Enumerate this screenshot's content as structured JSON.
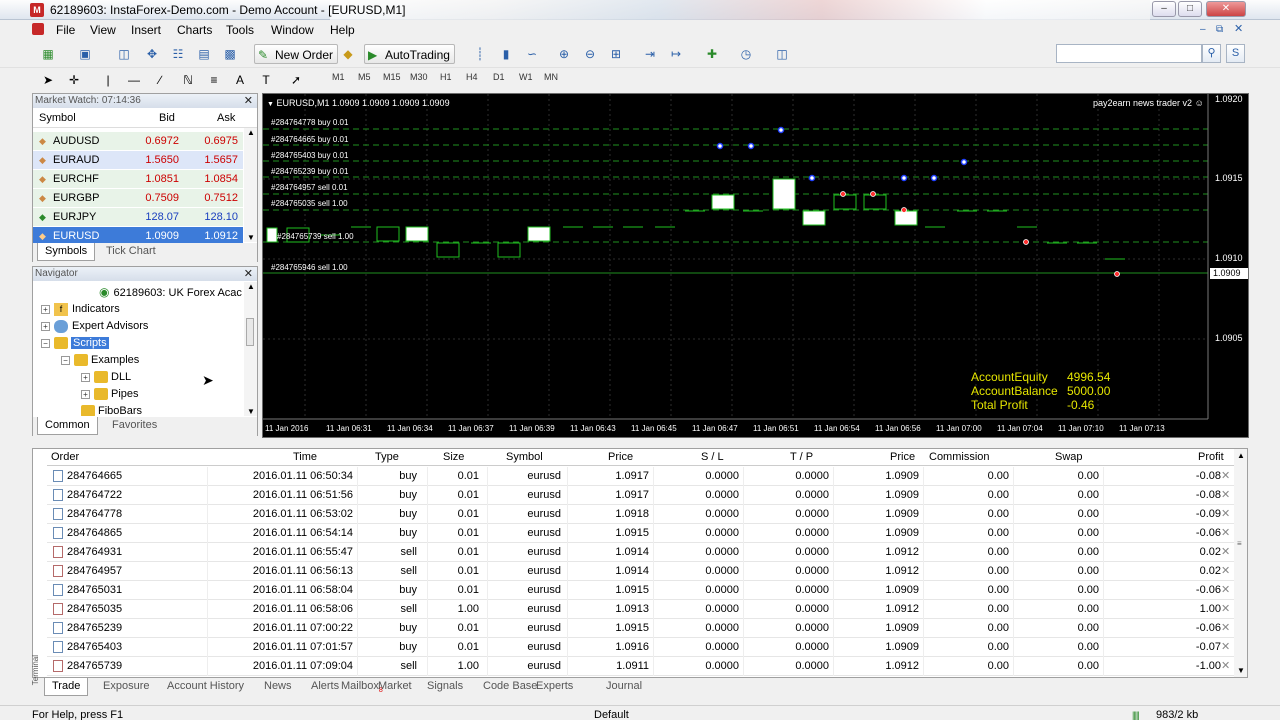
{
  "window": {
    "title": "62189603: InstaForex-Demo.com - Demo Account - [EURUSD,M1]"
  },
  "menu": [
    "File",
    "View",
    "Insert",
    "Charts",
    "Tools",
    "Window",
    "Help"
  ],
  "toolbar": {
    "new_order": "New Order",
    "autotrading": "AutoTrading"
  },
  "timeframes": [
    "M1",
    "M5",
    "M15",
    "M30",
    "H1",
    "H4",
    "D1",
    "W1",
    "MN"
  ],
  "market_watch": {
    "title": "Market Watch: 07:14:36",
    "columns": [
      "Symbol",
      "Bid",
      "Ask"
    ],
    "rows": [
      {
        "symbol": "AUDUSD",
        "bid": "0.6972",
        "ask": "0.6975"
      },
      {
        "symbol": "EURAUD",
        "bid": "1.5650",
        "ask": "1.5657"
      },
      {
        "symbol": "EURCHF",
        "bid": "1.0851",
        "ask": "1.0854"
      },
      {
        "symbol": "EURGBP",
        "bid": "0.7509",
        "ask": "0.7512"
      },
      {
        "symbol": "EURJPY",
        "bid": "128.07",
        "ask": "128.10"
      },
      {
        "symbol": "EURUSD",
        "bid": "1.0909",
        "ask": "1.0912"
      }
    ],
    "tabs": [
      "Symbols",
      "Tick Chart"
    ]
  },
  "navigator": {
    "title": "Navigator",
    "account": "62189603: UK Forex Acac",
    "items": [
      "Indicators",
      "Expert Advisors",
      "Scripts",
      "Examples",
      "DLL",
      "Pipes",
      "FiboBars"
    ],
    "tabs": [
      "Common",
      "Favorites"
    ]
  },
  "chart": {
    "header": "EURUSD,M1  1.0909 1.0909 1.0909 1.0909",
    "ea_label": "pay2earn news trader v2",
    "price_labels": [
      "1.0920",
      "1.0915",
      "1.0910",
      "1.0909",
      "1.0905"
    ],
    "time_labels": [
      "11 Jan 2016",
      "11 Jan 06:31",
      "11 Jan 06:34",
      "11 Jan 06:37",
      "11 Jan 06:39",
      "11 Jan 06:43",
      "11 Jan 06:45",
      "11 Jan 06:47",
      "11 Jan 06:51",
      "11 Jan 06:54",
      "11 Jan 06:56",
      "11 Jan 07:00",
      "11 Jan 07:04",
      "11 Jan 07:10",
      "11 Jan 07:13"
    ],
    "order_labels": [
      "#284764778 buy 0.01",
      "#284764665 buy 0.01",
      "#284765403 buy 0.01",
      "#284765239 buy 0.01",
      "#284764957 sell 0.01",
      "#284765035 sell 1.00",
      "#284765739 sell 1.00",
      "#284765946 sell 1.00"
    ],
    "info": [
      {
        "label": "AccountEquity",
        "value": "4996.54"
      },
      {
        "label": "AccountBalance",
        "value": "5000.00"
      },
      {
        "label": "Total Profit",
        "value": "-0.46"
      }
    ]
  },
  "terminal": {
    "columns": [
      "Order",
      "Time",
      "Type",
      "Size",
      "Symbol",
      "Price",
      "S / L",
      "T / P",
      "Price",
      "Commission",
      "Swap",
      "Profit"
    ],
    "rows": [
      [
        "284764665",
        "2016.01.11 06:50:34",
        "buy",
        "0.01",
        "eurusd",
        "1.0917",
        "0.0000",
        "0.0000",
        "1.0909",
        "0.00",
        "0.00",
        "-0.08"
      ],
      [
        "284764722",
        "2016.01.11 06:51:56",
        "buy",
        "0.01",
        "eurusd",
        "1.0917",
        "0.0000",
        "0.0000",
        "1.0909",
        "0.00",
        "0.00",
        "-0.08"
      ],
      [
        "284764778",
        "2016.01.11 06:53:02",
        "buy",
        "0.01",
        "eurusd",
        "1.0918",
        "0.0000",
        "0.0000",
        "1.0909",
        "0.00",
        "0.00",
        "-0.09"
      ],
      [
        "284764865",
        "2016.01.11 06:54:14",
        "buy",
        "0.01",
        "eurusd",
        "1.0915",
        "0.0000",
        "0.0000",
        "1.0909",
        "0.00",
        "0.00",
        "-0.06"
      ],
      [
        "284764931",
        "2016.01.11 06:55:47",
        "sell",
        "0.01",
        "eurusd",
        "1.0914",
        "0.0000",
        "0.0000",
        "1.0912",
        "0.00",
        "0.00",
        "0.02"
      ],
      [
        "284764957",
        "2016.01.11 06:56:13",
        "sell",
        "0.01",
        "eurusd",
        "1.0914",
        "0.0000",
        "0.0000",
        "1.0912",
        "0.00",
        "0.00",
        "0.02"
      ],
      [
        "284765031",
        "2016.01.11 06:58:04",
        "buy",
        "0.01",
        "eurusd",
        "1.0915",
        "0.0000",
        "0.0000",
        "1.0909",
        "0.00",
        "0.00",
        "-0.06"
      ],
      [
        "284765035",
        "2016.01.11 06:58:06",
        "sell",
        "1.00",
        "eurusd",
        "1.0913",
        "0.0000",
        "0.0000",
        "1.0912",
        "0.00",
        "0.00",
        "1.00"
      ],
      [
        "284765239",
        "2016.01.11 07:00:22",
        "buy",
        "0.01",
        "eurusd",
        "1.0915",
        "0.0000",
        "0.0000",
        "1.0909",
        "0.00",
        "0.00",
        "-0.06"
      ],
      [
        "284765403",
        "2016.01.11 07:01:57",
        "buy",
        "0.01",
        "eurusd",
        "1.0916",
        "0.0000",
        "0.0000",
        "1.0909",
        "0.00",
        "0.00",
        "-0.07"
      ],
      [
        "284765739",
        "2016.01.11 07:09:04",
        "sell",
        "1.00",
        "eurusd",
        "1.0911",
        "0.0000",
        "0.0000",
        "1.0912",
        "0.00",
        "0.00",
        "-1.00"
      ]
    ],
    "side_label": "Terminal",
    "tabs": [
      "Trade",
      "Exposure",
      "Account History",
      "News",
      "Alerts",
      "Mailbox",
      "Market",
      "Signals",
      "Code Base",
      "Experts",
      "Journal"
    ],
    "mailbox_badge": "8"
  },
  "status": {
    "help": "For Help, press F1",
    "profile": "Default",
    "traffic": "983/2 kb"
  }
}
